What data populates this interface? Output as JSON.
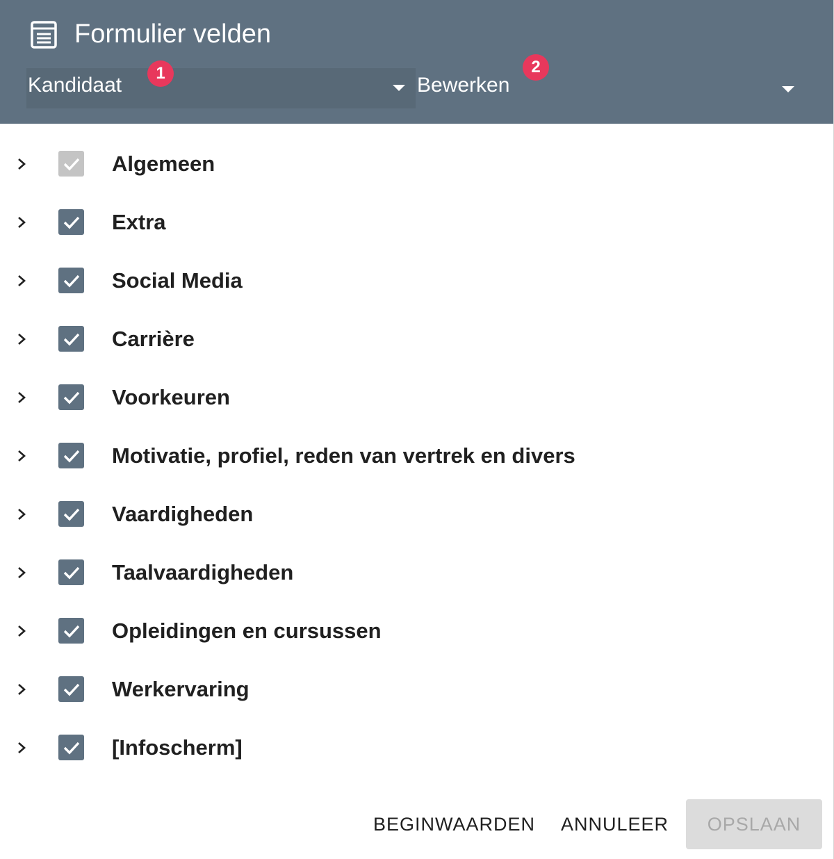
{
  "dialog": {
    "title": "Formulier velden",
    "title_icon": "form-list-icon"
  },
  "selects": {
    "entity": {
      "value": "Kandidaat",
      "badge": "1"
    },
    "mode": {
      "value": "Bewerken",
      "badge": "2"
    }
  },
  "sections": [
    {
      "label": "Algemeen",
      "checked": true,
      "disabled": true
    },
    {
      "label": "Extra",
      "checked": true,
      "disabled": false
    },
    {
      "label": "Social Media",
      "checked": true,
      "disabled": false
    },
    {
      "label": "Carrière",
      "checked": true,
      "disabled": false
    },
    {
      "label": "Voorkeuren",
      "checked": true,
      "disabled": false
    },
    {
      "label": "Motivatie, profiel, reden van vertrek en divers",
      "checked": true,
      "disabled": false
    },
    {
      "label": "Vaardigheden",
      "checked": true,
      "disabled": false
    },
    {
      "label": "Taalvaardigheden",
      "checked": true,
      "disabled": false
    },
    {
      "label": "Opleidingen en cursussen",
      "checked": true,
      "disabled": false
    },
    {
      "label": "Werkervaring",
      "checked": true,
      "disabled": false
    },
    {
      "label": "[Infoscherm]",
      "checked": true,
      "disabled": false
    }
  ],
  "footer": {
    "reset_label": "BEGINWAARDEN",
    "cancel_label": "ANNULEER",
    "save_label": "OPSLAAN"
  },
  "colors": {
    "header": "#5f7181",
    "checkbox": "#5f7181",
    "checkbox_disabled": "#c4c4c4",
    "badge": "#e8385c",
    "save_disabled_bg": "#dcdcdc"
  }
}
